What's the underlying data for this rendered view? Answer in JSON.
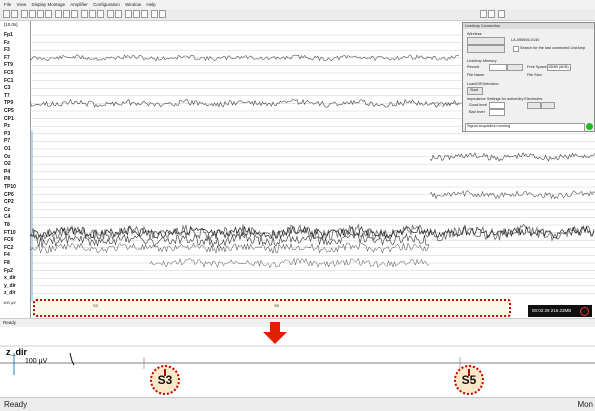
{
  "menu": [
    "File",
    "View",
    "Display Montage",
    "Amplifier",
    "Configuration",
    "Window",
    "Help"
  ],
  "main": {
    "scale_label": "[10.0s]",
    "channels": [
      "Fp1",
      "Fz",
      "F3",
      "F7",
      "FT9",
      "FC5",
      "FC1",
      "C3",
      "T7",
      "TP9",
      "CP5",
      "CP1",
      "Pz",
      "P3",
      "P7",
      "O1",
      "Oz",
      "O2",
      "P4",
      "P8",
      "TP10",
      "CP6",
      "CP2",
      "Cz",
      "C4",
      "T8",
      "FT10",
      "FC6",
      "FC2",
      "F4",
      "F8",
      "Fp2",
      "x_dir",
      "y_dir",
      "z_dir"
    ],
    "uv_label": "100 µV",
    "status_left": "Ready"
  },
  "dialog": {
    "title": "LiveAmp  Connection",
    "section_wireless": "Wireless",
    "serial": "LA-055606-0140",
    "search_label": "Search for the last connected LiveAmp",
    "section_memory": "LiveAmp Memory",
    "record_label": "Record",
    "free_space_label": "Free Space:",
    "free_space_value": "25MB (8KB)",
    "file_name_label": "File Name",
    "file_size_label": "File Size:",
    "section_loadoff": "Load/Off Detection",
    "start_label": "Start",
    "section_impedance": "Impedance Settings for active/dry Electrodes",
    "good_level": "Good level",
    "bad_level": "Bad level",
    "signal_text": "Signal acquisition running"
  },
  "status_box": "00:02:28   216.23MB",
  "markers_small": [
    "S3",
    "S5"
  ],
  "zoom": {
    "channel_label": "z_dir",
    "uv_label": "100 µV",
    "markers": [
      "S3",
      "S5"
    ],
    "status_left": "Ready",
    "status_right": "Mon"
  },
  "colors": {
    "marker_outline": "#c00000",
    "arrow": "#e02000",
    "status_ok": "#22bb22"
  }
}
